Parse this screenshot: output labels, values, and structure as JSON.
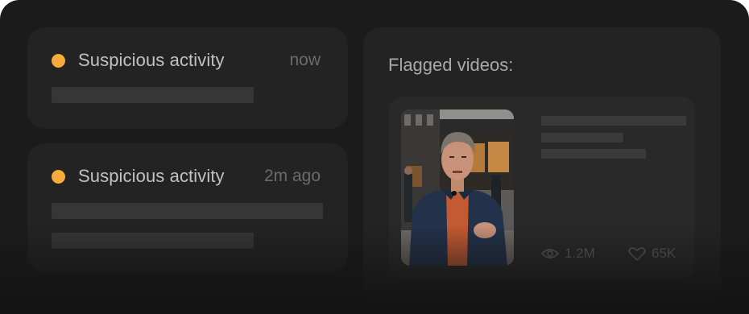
{
  "alerts": [
    {
      "title": "Suspicious activity",
      "time": "now"
    },
    {
      "title": "Suspicious activity",
      "time": "2m ago"
    }
  ],
  "flagged": {
    "title": "Flagged videos:",
    "video": {
      "views": "1.2M",
      "likes": "65K"
    }
  },
  "colors": {
    "alert_dot": "#f5ac3a",
    "background": "#1b1b1b",
    "card": "#232323"
  },
  "icons": [
    "eye-icon",
    "heart-icon"
  ]
}
